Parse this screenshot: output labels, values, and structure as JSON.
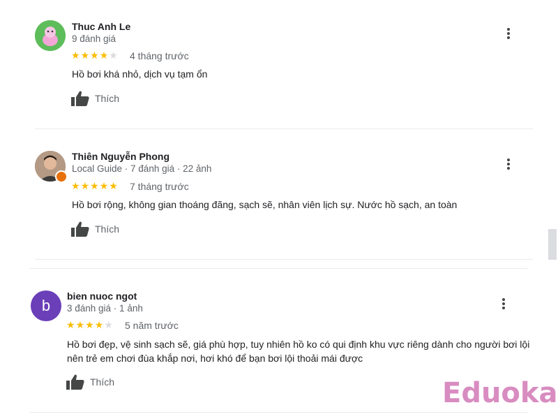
{
  "reviews": [
    {
      "name": "Thuc Anh Le",
      "meta": "9 đánh giá",
      "rating": 4,
      "time": "4 tháng trước",
      "text": "Hồ bơi khá nhỏ, dịch vụ tạm ổn",
      "like_label": "Thích"
    },
    {
      "name": "Thiên Nguyễn Phong",
      "meta": "Local Guide · 7 đánh giá · 22 ảnh",
      "rating": 5,
      "time": "7 tháng trước",
      "text": "Hồ bơi rộng, không gian thoáng đãng, sạch sẽ, nhân viên lịch sự. Nước hồ sạch, an toàn",
      "like_label": "Thích"
    },
    {
      "name": "bien nuoc ngot",
      "avatar_letter": "b",
      "meta": "3 đánh giá · 1 ảnh",
      "rating": 4,
      "time": "5 năm trước",
      "text": "Hồ bơi đẹp, vệ sinh sạch sẽ, giá phù hợp, tuy nhiên hồ ko có qui định khu vực riêng dành cho người bơi lội nên trẻ em chơi đùa khắp nơi, hơi khó để bạn bơi lội thoải mái được",
      "like_label": "Thích"
    }
  ],
  "watermark": "Eduoka",
  "icons": {
    "star": "star-icon",
    "like": "thumbs-up-icon",
    "more": "more-vert-icon"
  },
  "colors": {
    "star": "#fbbc04",
    "star_empty": "#dadce0",
    "watermark": "#d88cc0"
  }
}
